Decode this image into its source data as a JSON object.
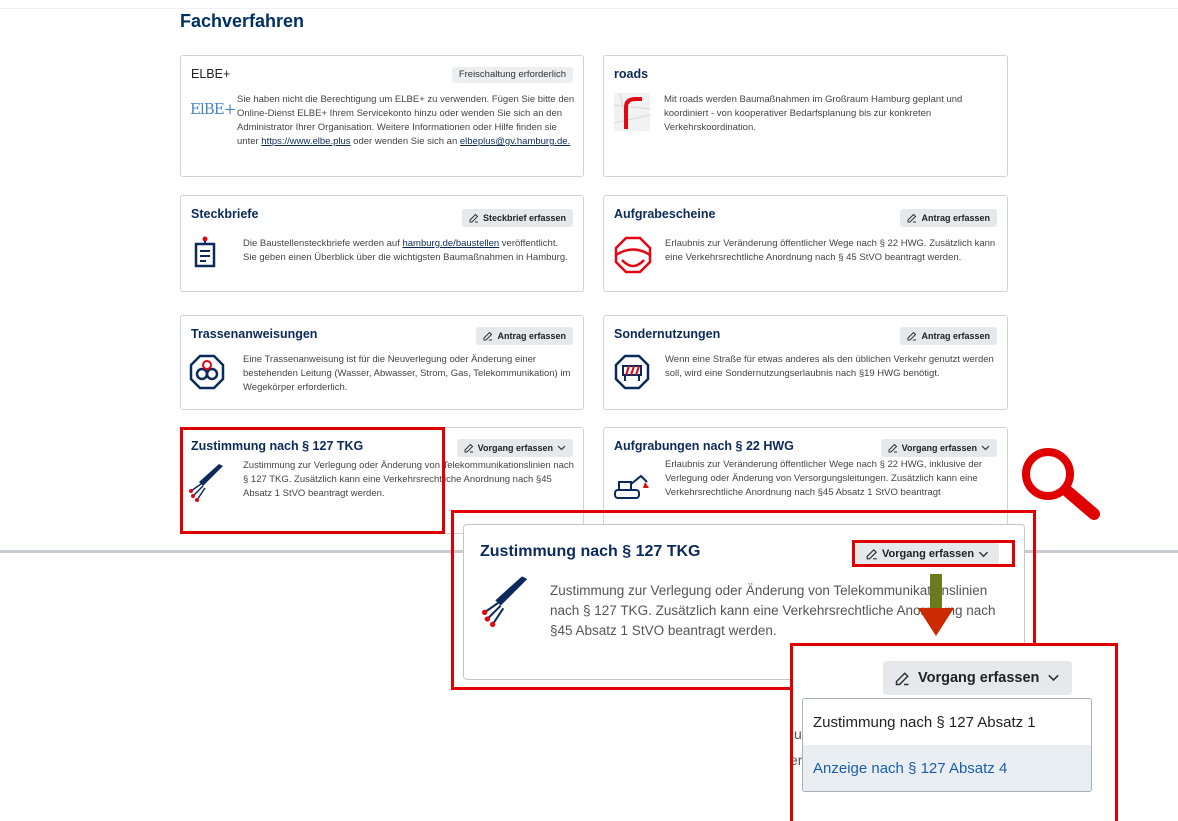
{
  "section_title": "Fachverfahren",
  "cards": {
    "elbe": {
      "title": "ELBE+",
      "badge": "Freischaltung erforderlich",
      "logo_text": "ElBE+",
      "text_before_link": "Sie haben nicht die Berechtigung um ELBE+ zu verwenden. Fügen Sie bitte den Online-Dienst ELBE+ Ihrem Servicekonto hinzu oder wenden Sie sich an den Administrator Ihrer Organisation. Weitere Informationen oder Hilfe finden sie unter ",
      "link1": "https://www.elbe.plus",
      "text_between": " oder wenden Sie sich an ",
      "link2": "elbeplus@gv.hamburg.de."
    },
    "roads": {
      "title": "roads",
      "text": "Mit roads werden Baumaßnahmen im Großraum Hamburg geplant und koordiniert - von kooperativer Bedarfsplanung bis zur konkreten Verkehrskoordination."
    },
    "steckbriefe": {
      "title": "Steckbriefe",
      "button": "Steckbrief erfassen",
      "text_before_link": "Die Baustellensteckbriefe werden auf ",
      "link": "hamburg.de/baustellen",
      "text_after_link": " veröffentlicht. Sie geben einen Überblick über die wichtigsten Baumaßnahmen in Hamburg."
    },
    "aufgrabescheine": {
      "title": "Aufgrabescheine",
      "button": "Antrag erfassen",
      "text": "Erlaubnis zur Veränderung öffentlicher Wege nach § 22 HWG. Zusätzlich kann eine Verkehrsrechtliche Anordnung nach § 45 StVO beantragt werden."
    },
    "trassen": {
      "title": "Trassenanweisungen",
      "button": "Antrag erfassen",
      "text": "Eine Trassenanweisung ist für die Neuverlegung oder Änderung einer bestehenden Leitung (Wasser, Abwasser, Strom, Gas, Telekommunikation) im Wegekörper erforderlich."
    },
    "sonder": {
      "title": "Sondernutzungen",
      "button": "Antrag erfassen",
      "text": "Wenn eine Straße für etwas anderes als den üblichen Verkehr genutzt werden soll, wird eine Sondernutzungserlaubnis nach §19 HWG benötigt."
    },
    "tkg": {
      "title": "Zustimmung nach § 127 TKG",
      "button": "Vorgang erfassen",
      "text": "Zustimmung zur Verlegung oder Änderung von Telekommunikationslinien nach § 127 TKG. Zusätzlich kann eine Verkehrsrechtliche Anordnung nach §45 Absatz 1 StVO beantragt werden."
    },
    "hwg": {
      "title": "Aufgrabungen nach § 22 HWG",
      "button": "Vorgang erfassen",
      "text": "Erlaubnis zur Veränderung öffentlicher Wege nach § 22 HWG, inklusive der Verlegung oder Änderung von Versorgungsleitungen. Zusätzlich kann eine Verkehrsrechtliche Anordnung nach §45 Absatz 1 StVO beantragt"
    }
  },
  "zoom": {
    "title": "Zustimmung nach § 127 TKG",
    "button": "Vorgang erfassen",
    "text": "Zustimmung zur Verlegung oder Änderung von Telekommunikationslinien nach § 127 TKG. Zusätzlich kann eine Verkehrsrechtliche Anordnung nach §45 Absatz 1 StVO beantragt werden."
  },
  "dropdown": {
    "button": "Vorgang erfassen",
    "items": [
      "Zustimmung nach § 127 Absatz 1",
      "Anzeige nach § 127 Absatz 4"
    ],
    "peek_1": "u",
    "peek_2": "er"
  },
  "colors": {
    "highlight": "#e00000",
    "title_navy": "#0b2a5b",
    "arrow": "#cc2a00",
    "icon_red": "#e30613"
  }
}
